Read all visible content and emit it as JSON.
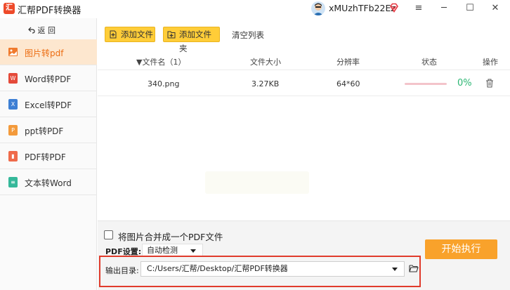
{
  "app": {
    "title": "汇帮PDF转换器",
    "logo_text": "汇",
    "username": "xMUzhTFb22Ez"
  },
  "window_controls": {
    "menu": "≡",
    "minimize": "─",
    "maximize": "☐",
    "close": "✕"
  },
  "sidebar": {
    "back_label": "返 回",
    "items": [
      {
        "label": "图片转pdf",
        "icon": "image-icon",
        "active": true
      },
      {
        "label": "Word转PDF",
        "icon": "word-icon"
      },
      {
        "label": "Excel转PDF",
        "icon": "excel-icon"
      },
      {
        "label": "ppt转PDF",
        "icon": "ppt-icon"
      },
      {
        "label": "PDF转PDF",
        "icon": "pdf-icon"
      },
      {
        "label": "文本转Word",
        "icon": "text-icon"
      }
    ]
  },
  "toolbar": {
    "add_file": "添加文件",
    "add_folder": "添加文件夹",
    "clear_list": "清空列表"
  },
  "table": {
    "headers": [
      "▼文件名（1）",
      "文件大小",
      "分辨率",
      "状态",
      "操作"
    ],
    "rows": [
      {
        "name": "340.png",
        "size": "3.27KB",
        "resolution": "64*60",
        "progress": 0,
        "percent": "0%"
      }
    ]
  },
  "bottom": {
    "merge_label": "将图片合并成一个PDF文件",
    "pdf_setting_label": "PDF设置:",
    "pdf_setting_value": "自动检测",
    "output_label": "输出目录:",
    "output_path": "C:/Users/汇帮/Desktop/汇帮PDF转换器",
    "start_button": "开始执行"
  },
  "colors": {
    "accent": "#f9a22b",
    "toolbar_button": "#ffcd38",
    "active_item_bg": "#fde7cf",
    "active_item_text": "#ec6d12",
    "highlight_frame": "#e03b2c",
    "status_percent": "#2bb673"
  }
}
